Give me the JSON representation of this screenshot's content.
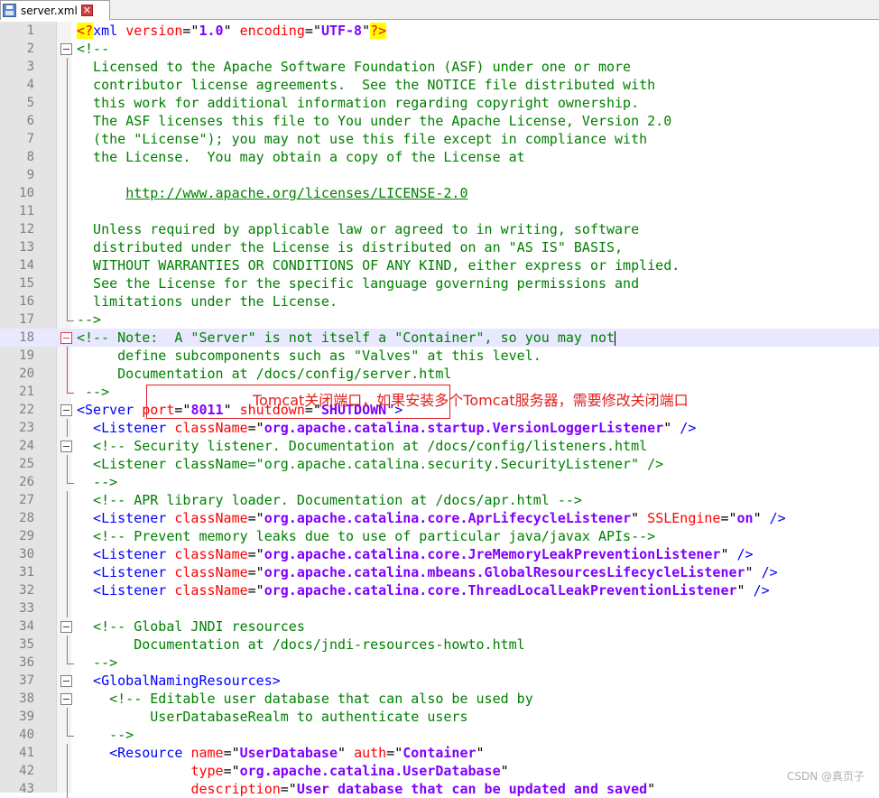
{
  "tab": {
    "file_name": "server.xml",
    "close_glyph": "✕",
    "save_icon": "floppy-disk-icon"
  },
  "annotation": "Tomcat关闭端口，如果安装多个Tomcat服务器，需要修改关闭端口",
  "watermark": "CSDN @真页子",
  "colors": {
    "comment": "#008000",
    "tag": "#0000ff",
    "attribute": "#ff0000",
    "value": "#8000ff",
    "annotation": "#e02020"
  },
  "current_line": 18,
  "lines": [
    {
      "n": 1,
      "segs": [
        [
          "<?",
          "pi"
        ],
        [
          "xml ",
          "tag"
        ],
        [
          "version",
          "attr"
        ],
        [
          "=\"",
          "t"
        ],
        [
          "1.0",
          "val"
        ],
        [
          "\" ",
          "t"
        ],
        [
          "encoding",
          "attr"
        ],
        [
          "=\"",
          "t"
        ],
        [
          "UTF-8",
          "val"
        ],
        [
          "\"",
          "t"
        ],
        [
          "?>",
          "pi"
        ]
      ]
    },
    {
      "n": 2,
      "fold": "box",
      "segs": [
        [
          "<!--",
          "com"
        ]
      ]
    },
    {
      "n": 3,
      "fold": "line",
      "segs": [
        [
          "  Licensed to the Apache Software Foundation (ASF) under one or more",
          "com"
        ]
      ]
    },
    {
      "n": 4,
      "fold": "line",
      "segs": [
        [
          "  contributor license agreements.  See the NOTICE file distributed with",
          "com"
        ]
      ]
    },
    {
      "n": 5,
      "fold": "line",
      "segs": [
        [
          "  this work for additional information regarding copyright ownership.",
          "com"
        ]
      ]
    },
    {
      "n": 6,
      "fold": "line",
      "segs": [
        [
          "  The ASF licenses this file to You under the Apache License, Version 2.0",
          "com"
        ]
      ]
    },
    {
      "n": 7,
      "fold": "line",
      "segs": [
        [
          "  (the \"License\"); you may not use this file except in compliance with",
          "com"
        ]
      ]
    },
    {
      "n": 8,
      "fold": "line",
      "segs": [
        [
          "  the License.  You may obtain a copy of the License at",
          "com"
        ]
      ]
    },
    {
      "n": 9,
      "fold": "line",
      "segs": []
    },
    {
      "n": 10,
      "fold": "line",
      "segs": [
        [
          "      ",
          "com"
        ],
        [
          "http://www.apache.org/licenses/LICENSE-2.0",
          "link"
        ]
      ]
    },
    {
      "n": 11,
      "fold": "line",
      "segs": []
    },
    {
      "n": 12,
      "fold": "line",
      "segs": [
        [
          "  Unless required by applicable law or agreed to in writing, software",
          "com"
        ]
      ]
    },
    {
      "n": 13,
      "fold": "line",
      "segs": [
        [
          "  distributed under the License is distributed on an \"AS IS\" BASIS,",
          "com"
        ]
      ]
    },
    {
      "n": 14,
      "fold": "line",
      "segs": [
        [
          "  WITHOUT WARRANTIES OR CONDITIONS OF ANY KIND, either express or implied.",
          "com"
        ]
      ]
    },
    {
      "n": 15,
      "fold": "line",
      "segs": [
        [
          "  See the License for the specific language governing permissions and",
          "com"
        ]
      ]
    },
    {
      "n": 16,
      "fold": "line",
      "segs": [
        [
          "  limitations under the License.",
          "com"
        ]
      ]
    },
    {
      "n": 17,
      "fold": "end",
      "segs": [
        [
          "-->",
          "com"
        ]
      ]
    },
    {
      "n": 18,
      "fold": "boxred",
      "segs": [
        [
          "<!-- Note:  A \"Server\" is not itself a \"Container\", so you may not",
          "com"
        ]
      ],
      "cursor": true
    },
    {
      "n": 19,
      "fold": "linered",
      "segs": [
        [
          "     define subcomponents such as \"Valves\" at this level.",
          "com"
        ]
      ]
    },
    {
      "n": 20,
      "fold": "linered",
      "segs": [
        [
          "     Documentation at /docs/config/server.html",
          "com"
        ]
      ]
    },
    {
      "n": 21,
      "fold": "endred",
      "segs": [
        [
          " -->",
          "com"
        ]
      ]
    },
    {
      "n": 22,
      "fold": "box",
      "segs": [
        [
          "<Server ",
          "tag"
        ],
        [
          "port",
          "attr"
        ],
        [
          "=\"",
          "t"
        ],
        [
          "8011",
          "val"
        ],
        [
          "\" ",
          "t"
        ],
        [
          "shutdown",
          "attr"
        ],
        [
          "=\"",
          "t"
        ],
        [
          "SHUTDOWN",
          "val"
        ],
        [
          "\">",
          "tag"
        ]
      ]
    },
    {
      "n": 23,
      "fold": "line",
      "segs": [
        [
          "  <Listener ",
          "tag"
        ],
        [
          "className",
          "attr"
        ],
        [
          "=\"",
          "t"
        ],
        [
          "org.apache.catalina.startup.VersionLoggerListener",
          "val"
        ],
        [
          "\" ",
          "t"
        ],
        [
          "/>",
          "tag"
        ]
      ]
    },
    {
      "n": 24,
      "fold": "box",
      "segs": [
        [
          "  <!-- Security listener. Documentation at /docs/config/listeners.html",
          "com"
        ]
      ]
    },
    {
      "n": 25,
      "fold": "line",
      "segs": [
        [
          "  <Listener className=\"org.apache.catalina.security.SecurityListener\" />",
          "com"
        ]
      ]
    },
    {
      "n": 26,
      "fold": "end",
      "segs": [
        [
          "  -->",
          "com"
        ]
      ]
    },
    {
      "n": 27,
      "fold": "line",
      "segs": [
        [
          "  <!-- APR library loader. Documentation at /docs/apr.html -->",
          "com"
        ]
      ]
    },
    {
      "n": 28,
      "fold": "line",
      "segs": [
        [
          "  <Listener ",
          "tag"
        ],
        [
          "className",
          "attr"
        ],
        [
          "=\"",
          "t"
        ],
        [
          "org.apache.catalina.core.AprLifecycleListener",
          "val"
        ],
        [
          "\" ",
          "t"
        ],
        [
          "SSLEngine",
          "attr"
        ],
        [
          "=\"",
          "t"
        ],
        [
          "on",
          "val"
        ],
        [
          "\" ",
          "t"
        ],
        [
          "/>",
          "tag"
        ]
      ]
    },
    {
      "n": 29,
      "fold": "line",
      "segs": [
        [
          "  <!-- Prevent memory leaks due to use of particular java/javax APIs-->",
          "com"
        ]
      ]
    },
    {
      "n": 30,
      "fold": "line",
      "segs": [
        [
          "  <Listener ",
          "tag"
        ],
        [
          "className",
          "attr"
        ],
        [
          "=\"",
          "t"
        ],
        [
          "org.apache.catalina.core.JreMemoryLeakPreventionListener",
          "val"
        ],
        [
          "\" ",
          "t"
        ],
        [
          "/>",
          "tag"
        ]
      ]
    },
    {
      "n": 31,
      "fold": "line",
      "segs": [
        [
          "  <Listener ",
          "tag"
        ],
        [
          "className",
          "attr"
        ],
        [
          "=\"",
          "t"
        ],
        [
          "org.apache.catalina.mbeans.GlobalResourcesLifecycleListener",
          "val"
        ],
        [
          "\" ",
          "t"
        ],
        [
          "/>",
          "tag"
        ]
      ]
    },
    {
      "n": 32,
      "fold": "line",
      "segs": [
        [
          "  <Listener ",
          "tag"
        ],
        [
          "className",
          "attr"
        ],
        [
          "=\"",
          "t"
        ],
        [
          "org.apache.catalina.core.ThreadLocalLeakPreventionListener",
          "val"
        ],
        [
          "\" ",
          "t"
        ],
        [
          "/>",
          "tag"
        ]
      ]
    },
    {
      "n": 33,
      "fold": "line",
      "segs": []
    },
    {
      "n": 34,
      "fold": "box",
      "segs": [
        [
          "  <!-- Global JNDI resources",
          "com"
        ]
      ]
    },
    {
      "n": 35,
      "fold": "line",
      "segs": [
        [
          "       Documentation at /docs/jndi-resources-howto.html",
          "com"
        ]
      ]
    },
    {
      "n": 36,
      "fold": "end",
      "segs": [
        [
          "  -->",
          "com"
        ]
      ]
    },
    {
      "n": 37,
      "fold": "box",
      "segs": [
        [
          "  <GlobalNamingResources>",
          "tag"
        ]
      ]
    },
    {
      "n": 38,
      "fold": "box",
      "segs": [
        [
          "    <!-- Editable user database that can also be used by",
          "com"
        ]
      ]
    },
    {
      "n": 39,
      "fold": "line",
      "segs": [
        [
          "         UserDatabaseRealm to authenticate users",
          "com"
        ]
      ]
    },
    {
      "n": 40,
      "fold": "end",
      "segs": [
        [
          "    -->",
          "com"
        ]
      ]
    },
    {
      "n": 41,
      "fold": "line",
      "segs": [
        [
          "    <Resource ",
          "tag"
        ],
        [
          "name",
          "attr"
        ],
        [
          "=\"",
          "t"
        ],
        [
          "UserDatabase",
          "val"
        ],
        [
          "\" ",
          "t"
        ],
        [
          "auth",
          "attr"
        ],
        [
          "=\"",
          "t"
        ],
        [
          "Container",
          "val"
        ],
        [
          "\"",
          "t"
        ]
      ]
    },
    {
      "n": 42,
      "fold": "line",
      "segs": [
        [
          "              ",
          "t"
        ],
        [
          "type",
          "attr"
        ],
        [
          "=\"",
          "t"
        ],
        [
          "org.apache.catalina.UserDatabase",
          "val"
        ],
        [
          "\"",
          "t"
        ]
      ]
    },
    {
      "n": 43,
      "fold": "line",
      "segs": [
        [
          "              ",
          "t"
        ],
        [
          "description",
          "attr"
        ],
        [
          "=\"",
          "t"
        ],
        [
          "User database that can be updated and saved",
          "val"
        ],
        [
          "\"",
          "t"
        ]
      ]
    }
  ]
}
